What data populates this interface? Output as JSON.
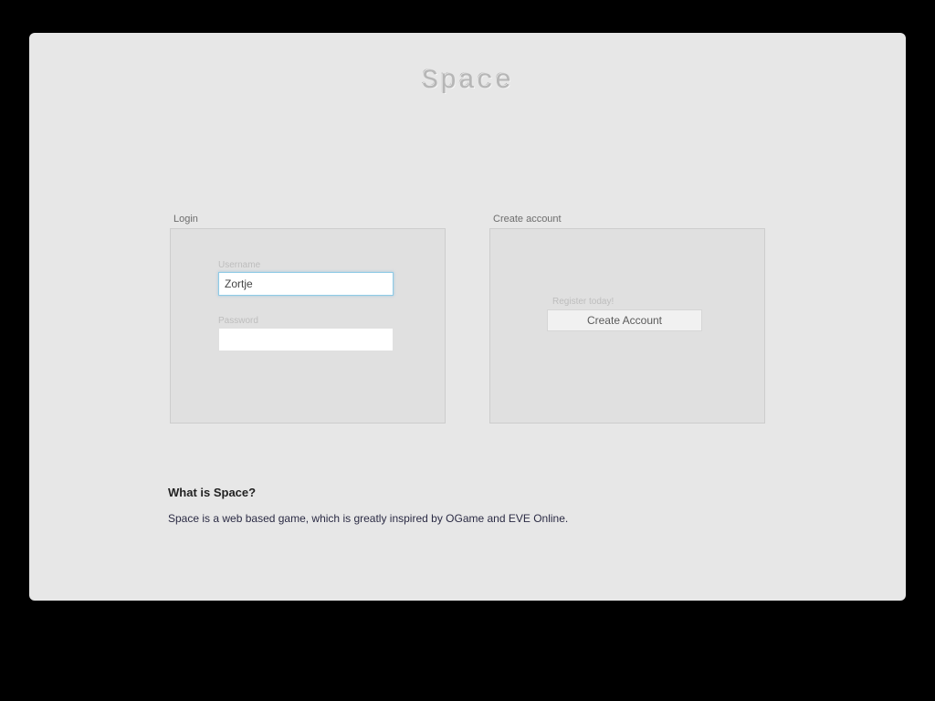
{
  "title": "Space",
  "login": {
    "panel_label": "Login",
    "username_label": "Username",
    "username_value": "Zortje",
    "password_label": "Password",
    "password_value": ""
  },
  "register": {
    "panel_label": "Create account",
    "prompt": "Register today!",
    "button_label": "Create Account"
  },
  "about": {
    "heading": "What is Space?",
    "body": "Space is a web based game, which is greatly inspired by OGame and EVE Online."
  }
}
